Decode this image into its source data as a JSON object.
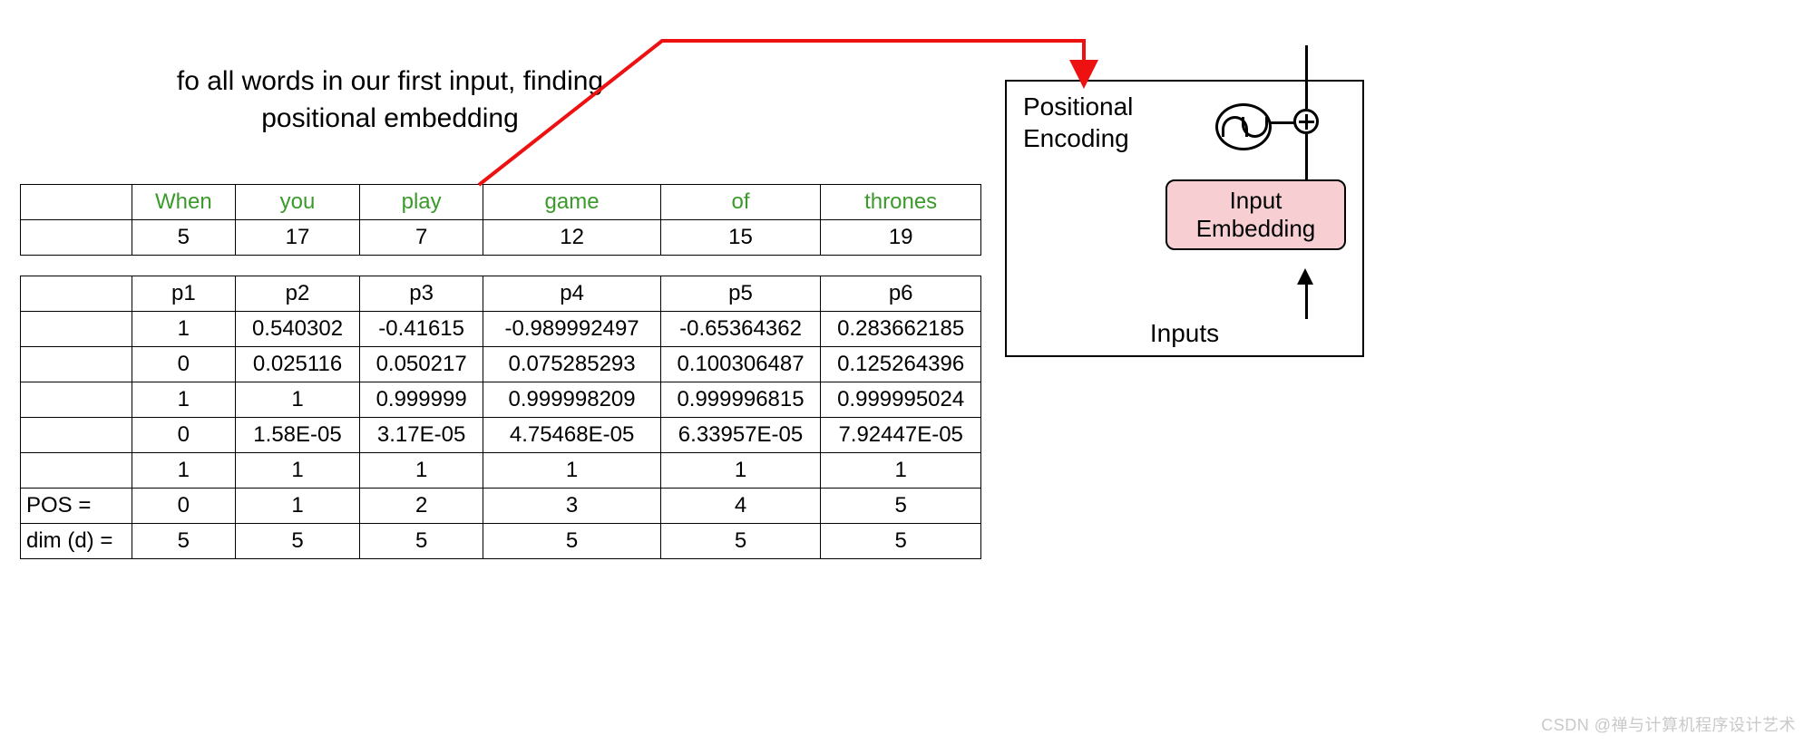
{
  "heading_line1": "fo all words in our first input, finding",
  "heading_line2": "positional embedding",
  "words": [
    "When",
    "you",
    "play",
    "game",
    "of",
    "thrones"
  ],
  "word_ids": [
    "5",
    "17",
    "7",
    "12",
    "15",
    "19"
  ],
  "p_labels": [
    "p1",
    "p2",
    "p3",
    "p4",
    "p5",
    "p6"
  ],
  "rows": [
    [
      "1",
      "0.540302",
      "-0.41615",
      "-0.989992497",
      "-0.65364362",
      "0.283662185"
    ],
    [
      "0",
      "0.025116",
      "0.050217",
      "0.075285293",
      "0.100306487",
      "0.125264396"
    ],
    [
      "1",
      "1",
      "0.999999",
      "0.999998209",
      "0.999996815",
      "0.999995024"
    ],
    [
      "0",
      "1.58E-05",
      "3.17E-05",
      "4.75468E-05",
      "6.33957E-05",
      "7.92447E-05"
    ],
    [
      "1",
      "1",
      "1",
      "1",
      "1",
      "1"
    ]
  ],
  "pos_label": "POS =",
  "pos_values": [
    "0",
    "1",
    "2",
    "3",
    "4",
    "5"
  ],
  "dim_label": "dim (d) =",
  "dim_values": [
    "5",
    "5",
    "5",
    "5",
    "5",
    "5"
  ],
  "block": {
    "pe_label_l1": "Positional",
    "pe_label_l2": "Encoding",
    "embed_l1": "Input",
    "embed_l2": "Embedding",
    "inputs": "Inputs"
  },
  "watermark": "CSDN @禅与计算机程序设计艺术",
  "chart_data": {
    "type": "table",
    "title": "Positional embedding values for first input sentence",
    "columns": [
      "When",
      "you",
      "play",
      "game",
      "of",
      "thrones"
    ],
    "token_ids": [
      5,
      17,
      7,
      12,
      15,
      19
    ],
    "position_labels": [
      "p1",
      "p2",
      "p3",
      "p4",
      "p5",
      "p6"
    ],
    "embedding_rows": [
      [
        1,
        0.540302,
        -0.41615,
        -0.989992497,
        -0.65364362,
        0.283662185
      ],
      [
        0,
        0.025116,
        0.050217,
        0.075285293,
        0.100306487,
        0.125264396
      ],
      [
        1,
        1,
        0.999999,
        0.999998209,
        0.999996815,
        0.999995024
      ],
      [
        0,
        1.58e-05,
        3.17e-05,
        4.75468e-05,
        6.33957e-05,
        7.92447e-05
      ],
      [
        1,
        1,
        1,
        1,
        1,
        1
      ]
    ],
    "POS": [
      0,
      1,
      2,
      3,
      4,
      5
    ],
    "dim_d": [
      5,
      5,
      5,
      5,
      5,
      5
    ]
  }
}
